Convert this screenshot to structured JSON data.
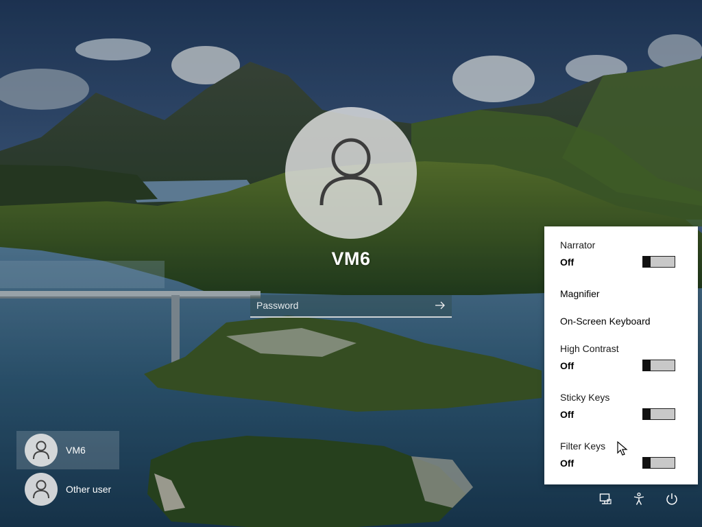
{
  "login": {
    "username": "VM6",
    "password_placeholder": "Password",
    "password_value": ""
  },
  "users": [
    {
      "name": "VM6",
      "selected": true,
      "icon": "person-icon"
    },
    {
      "name": "Other user",
      "selected": false,
      "icon": "person-icon"
    }
  ],
  "ease_of_access": {
    "items": [
      {
        "label": "Narrator",
        "type": "toggle",
        "state": "Off",
        "on": false
      },
      {
        "label": "Magnifier",
        "type": "link"
      },
      {
        "label": "On-Screen Keyboard",
        "type": "link"
      },
      {
        "label": "High Contrast",
        "type": "toggle",
        "state": "Off",
        "on": false
      },
      {
        "label": "Sticky Keys",
        "type": "toggle",
        "state": "Off",
        "on": false
      },
      {
        "label": "Filter Keys",
        "type": "toggle",
        "state": "Off",
        "on": false
      }
    ]
  },
  "system_icons": [
    "network-icon",
    "accessibility-icon",
    "power-icon"
  ],
  "colors": {
    "flyout_bg": "#ffffff",
    "toggle_off_track": "#c8c8c8",
    "toggle_knob": "#111111",
    "avatar_bg": "#e1e1e1"
  }
}
